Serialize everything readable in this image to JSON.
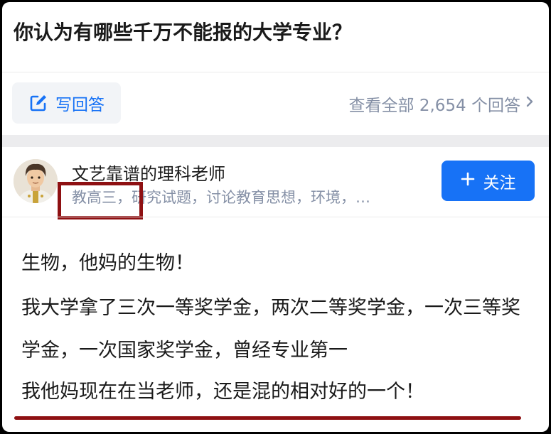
{
  "question": {
    "title": "你认为有哪些千万不能报的大学专业？"
  },
  "actions": {
    "write_answer_label": "写回答",
    "view_all_label": "查看全部 2,654 个回答",
    "view_all_icon": "chevron-right-icon"
  },
  "author": {
    "name": "文艺靠谱的理科老师",
    "bio": "教高三，研究试题，讨论教育思想，环境，…",
    "follow_label": "关注",
    "follow_icon": "plus-icon"
  },
  "answer": {
    "paragraphs": [
      "生物，他妈的生物！",
      "我大学拿了三次一等奖学金，两次二等奖学金，一次三等奖学金，一次国家奖学金，曾经专业第一",
      "我他妈现在在当老师，还是混的相对好的一个！"
    ]
  },
  "colors": {
    "accent_blue": "#1772f6",
    "muted_gray": "#8590a6",
    "annotation_red": "#8e1012",
    "text_dark": "#1a1a1a"
  }
}
